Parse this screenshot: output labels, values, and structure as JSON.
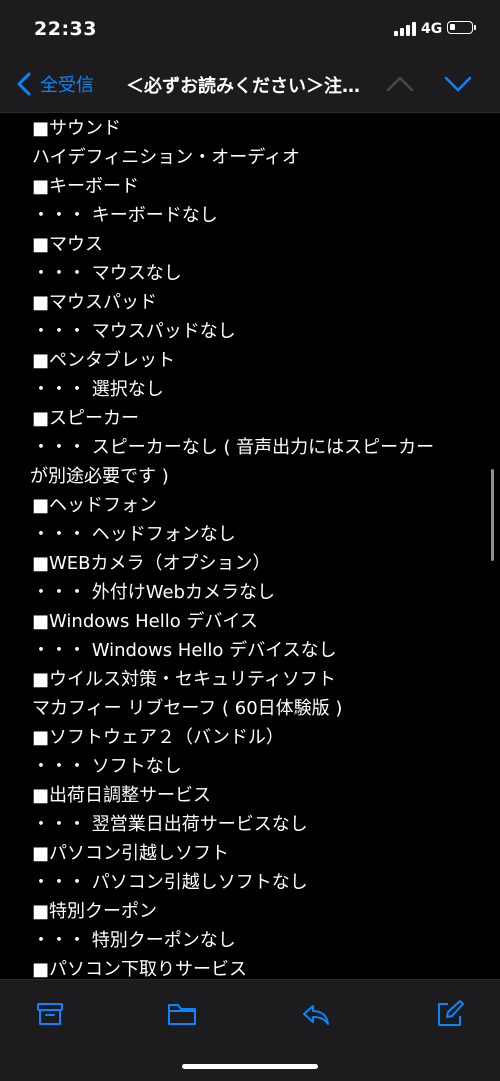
{
  "status_bar": {
    "time": "22:33",
    "network": "4G"
  },
  "nav": {
    "back_label": "全受信",
    "title": "＜必ずお読みください＞注…"
  },
  "message_lines": [
    "■サウンド",
    " ハイデフィニション・オーディオ",
    " ・・・ キーボードなし",
    "■キーボード",
    "■マウス",
    " ・・・ マウスなし",
    "■マウスパッド",
    " ・・・ マウスパッドなし",
    "■ペンタブレット",
    " ・・・ 選択なし",
    "■スピーカー",
    " ・・・ スピーカーなし ( 音声出力にはスピーカー",
    "が別途必要です )",
    "■ヘッドフォン",
    " ・・・ ヘッドフォンなし",
    "■WEBカメラ（オプション）",
    " ・・・ 外付けWebカメラなし",
    "■Windows Hello デバイス",
    " ・・・ Windows Hello デバイスなし",
    "■ウイルス対策・セキュリティソフト",
    " マカフィー リブセーフ ( 60日体験版 )",
    "■ソフトウェア２（バンドル）",
    " ・・・ ソフトなし",
    "■出荷日調整サービス",
    " ・・・ 翌営業日出荷サービスなし",
    "■パソコン引越しソフト",
    " ・・・ パソコン引越しソフトなし",
    "■特別クーポン",
    " ・・・ 特別クーポンなし",
    "■パソコン下取りサービス"
  ],
  "toolbar": {
    "archive_icon": "archive-box-icon",
    "folder_icon": "folder-icon",
    "reply_icon": "reply-icon",
    "compose_icon": "compose-icon"
  },
  "colors": {
    "accent": "#0a84ff",
    "bar_background": "#1c1c1e",
    "content_background": "#000000",
    "text": "#ffffff"
  }
}
